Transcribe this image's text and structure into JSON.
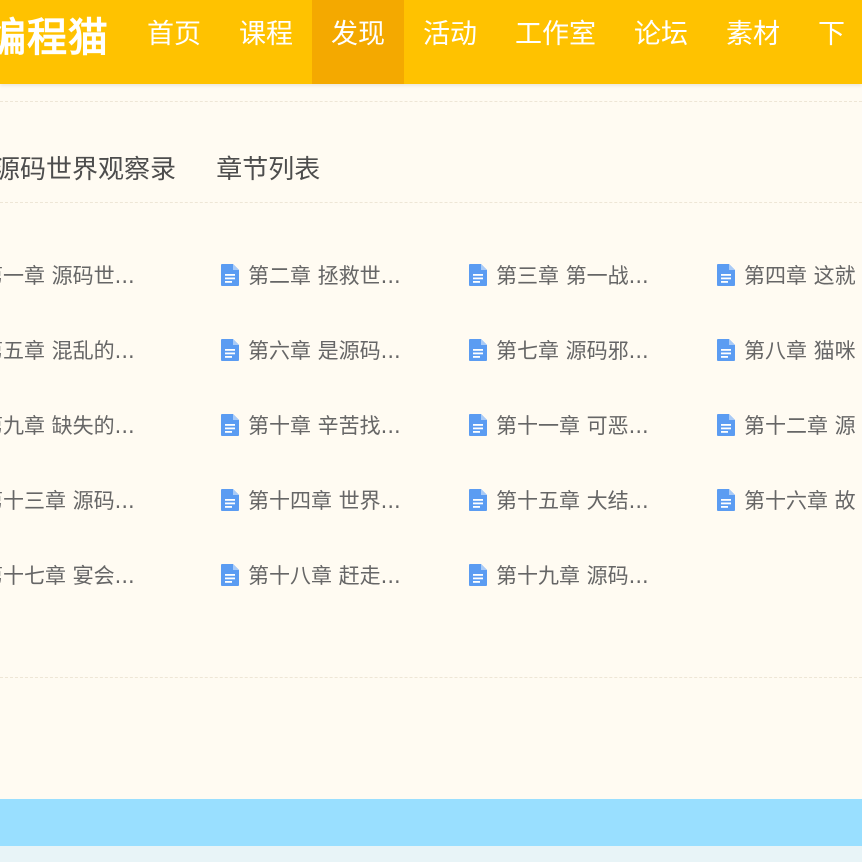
{
  "header": {
    "logo_text": "编程猫",
    "nav": [
      {
        "label": "首页",
        "active": false
      },
      {
        "label": "课程",
        "active": false
      },
      {
        "label": "发现",
        "active": true
      },
      {
        "label": "活动",
        "active": false
      },
      {
        "label": "工作室",
        "active": false
      },
      {
        "label": "论坛",
        "active": false
      },
      {
        "label": "素材",
        "active": false
      },
      {
        "label": "下",
        "active": false
      }
    ],
    "accent_color": "#ffc200",
    "active_color": "#f4a900"
  },
  "page": {
    "book_title": "源码世界观察录",
    "section_title": "章节列表"
  },
  "chapters": [
    {
      "name": "第一章 源码世...",
      "icon": "document-icon"
    },
    {
      "name": "第二章 拯救世...",
      "icon": "document-icon"
    },
    {
      "name": "第三章 第一战...",
      "icon": "document-icon"
    },
    {
      "name": "第四章 这就",
      "icon": "document-icon"
    },
    {
      "name": "第五章 混乱的...",
      "icon": "document-icon"
    },
    {
      "name": "第六章 是源码...",
      "icon": "document-icon"
    },
    {
      "name": "第七章 源码邪...",
      "icon": "document-icon"
    },
    {
      "name": "第八章 猫咪",
      "icon": "document-icon"
    },
    {
      "name": "第九章 缺失的...",
      "icon": "document-icon"
    },
    {
      "name": "第十章 辛苦找...",
      "icon": "document-icon"
    },
    {
      "name": "第十一章 可恶...",
      "icon": "document-icon"
    },
    {
      "name": "第十二章 源",
      "icon": "document-icon"
    },
    {
      "name": "第十三章 源码...",
      "icon": "document-icon"
    },
    {
      "name": "第十四章 世界...",
      "icon": "document-icon"
    },
    {
      "name": "第十五章 大结...",
      "icon": "document-icon"
    },
    {
      "name": "第十六章 故",
      "icon": "document-icon"
    },
    {
      "name": "第十七章 宴会...",
      "icon": "document-icon"
    },
    {
      "name": "第十八章 赶走...",
      "icon": "document-icon"
    },
    {
      "name": "第十九章 源码...",
      "icon": "document-icon"
    }
  ],
  "footer": {
    "band_color": "#99dfff"
  }
}
